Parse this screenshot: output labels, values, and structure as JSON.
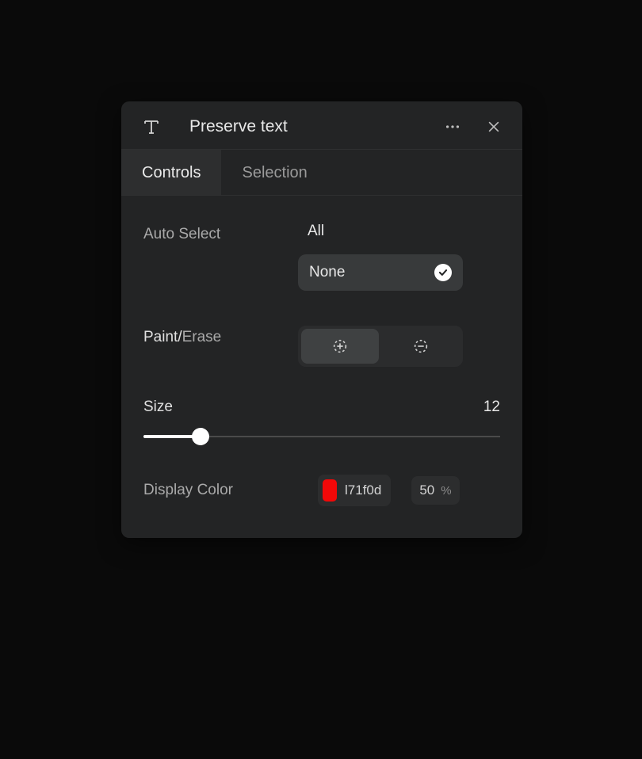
{
  "header": {
    "title": "Preserve text"
  },
  "tabs": {
    "controls": "Controls",
    "selection": "Selection"
  },
  "autoSelect": {
    "label": "Auto Select",
    "all": "All",
    "none": "None"
  },
  "paintErase": {
    "paint": "Paint",
    "slash": "/",
    "erase": "Erase"
  },
  "size": {
    "label": "Size",
    "value": "12",
    "percent": 16
  },
  "displayColor": {
    "label": "Display Color",
    "hex": "l71f0d",
    "swatch": "#f20808",
    "opacity": "50",
    "unit": "%"
  }
}
